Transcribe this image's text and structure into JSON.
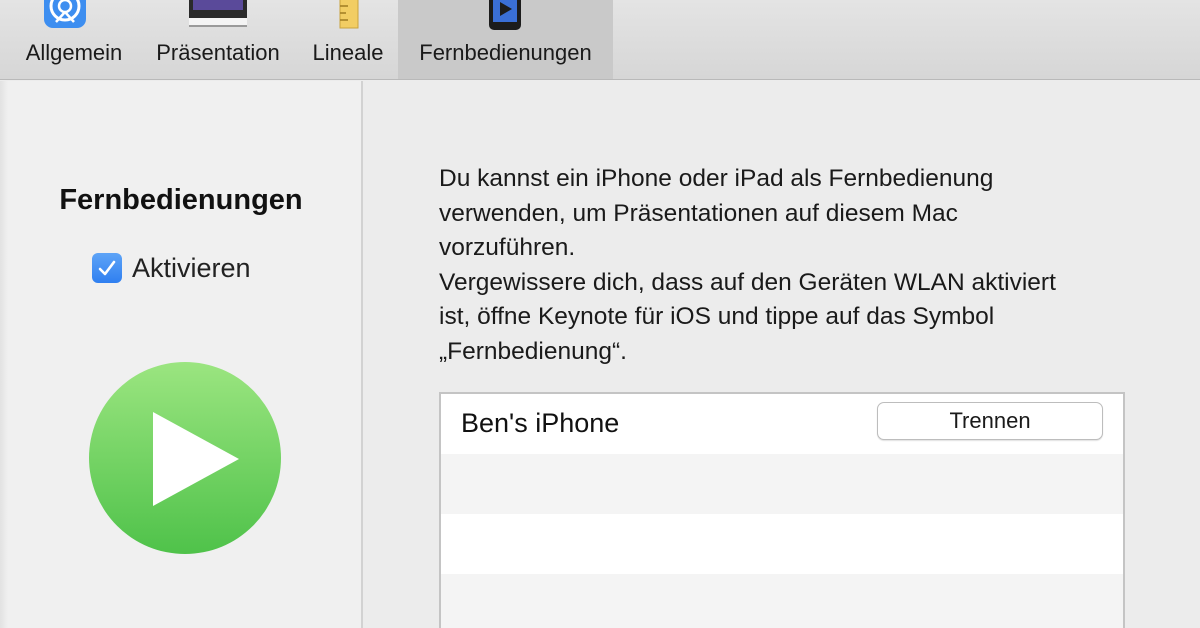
{
  "toolbar": {
    "items": [
      {
        "label": "Allgemein",
        "icon": "gear-icon",
        "active": false
      },
      {
        "label": "Präsentation",
        "icon": "presentation-icon",
        "active": false
      },
      {
        "label": "Lineale",
        "icon": "ruler-icon",
        "active": false
      },
      {
        "label": "Fernbedienungen",
        "icon": "remote-iphone-icon",
        "active": true
      }
    ]
  },
  "sidebar": {
    "title": "Fernbedienungen",
    "checkbox_label": "Aktivieren",
    "checkbox_checked": true,
    "icon": "play-icon"
  },
  "main": {
    "description_1": "Du kannst ein iPhone oder iPad als Fernbedienung verwenden, um Präsentationen auf diesem Mac vorzuführen.",
    "description_2": "Vergewissere dich, dass auf den Geräten WLAN aktiviert ist, öffne Keynote für iOS und tippe auf das Symbol „Fernbedienung“.",
    "devices": [
      {
        "name": "Ben's iPhone",
        "button_label": "Trennen"
      }
    ]
  },
  "colors": {
    "accent": "#2f7ff0",
    "play_green": "#6ed45a"
  }
}
